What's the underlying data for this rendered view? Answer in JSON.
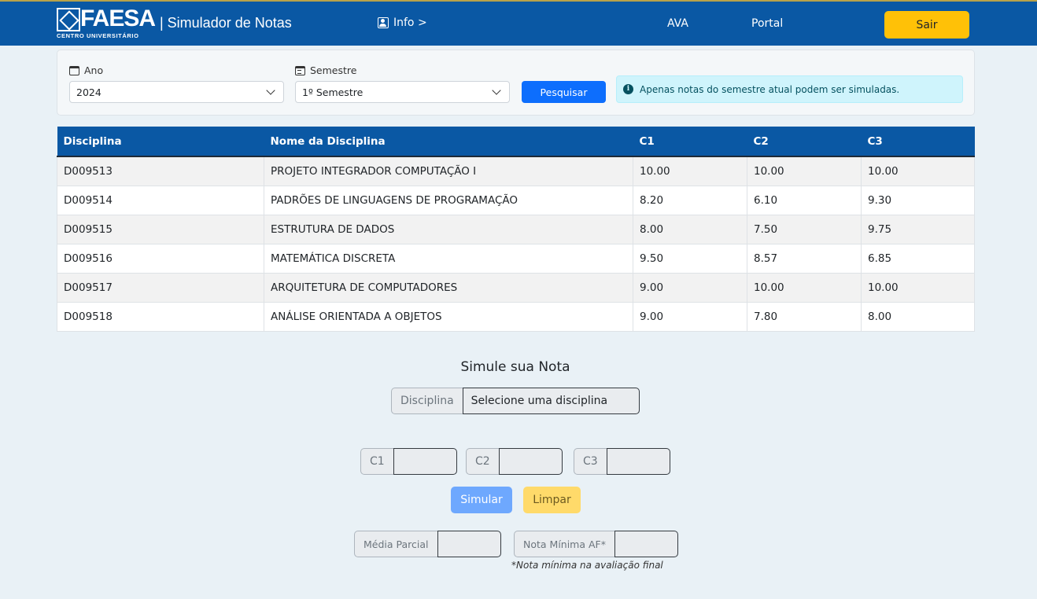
{
  "header": {
    "logo_text": "FAESA",
    "logo_subtext": "CENTRO UNIVERSITÁRIO",
    "app_title": "| Simulador de Notas",
    "info_label": "Info >",
    "nav_ava": "AVA",
    "nav_portal": "Portal",
    "logout_label": "Sair"
  },
  "filters": {
    "year_label": "Ano",
    "year_value": "2024",
    "semester_label": "Semestre",
    "semester_value": "1º Semestre",
    "search_label": "Pesquisar",
    "alert_text": "Apenas notas do semestre atual podem ser simuladas."
  },
  "table": {
    "headers": [
      "Disciplina",
      "Nome da Disciplina",
      "C1",
      "C2",
      "C3"
    ],
    "rows": [
      [
        "D009513",
        "PROJETO INTEGRADOR COMPUTAÇÃO I",
        "10.00",
        "10.00",
        "10.00"
      ],
      [
        "D009514",
        "PADRÕES DE LINGUAGENS DE PROGRAMAÇÃO",
        "8.20",
        "6.10",
        "9.30"
      ],
      [
        "D009515",
        "ESTRUTURA DE DADOS",
        "8.00",
        "7.50",
        "9.75"
      ],
      [
        "D009516",
        "MATEMÁTICA DISCRETA",
        "9.50",
        "8.57",
        "6.85"
      ],
      [
        "D009517",
        "ARQUITETURA DE COMPUTADORES",
        "9.00",
        "10.00",
        "10.00"
      ],
      [
        "D009518",
        "ANÁLISE ORIENTADA A OBJETOS",
        "9.00",
        "7.80",
        "8.00"
      ]
    ]
  },
  "simulator": {
    "title": "Simule sua Nota",
    "discipline_label": "Disciplina",
    "discipline_value": "Selecione uma disciplina",
    "c1_label": "C1",
    "c1_value": "",
    "c2_label": "C2",
    "c2_value": "",
    "c3_label": "C3",
    "c3_value": "",
    "simulate_label": "Simular",
    "clear_label": "Limpar",
    "partial_avg_label": "Média Parcial",
    "partial_avg_value": "",
    "min_grade_label": "Nota Mínima AF*",
    "min_grade_value": "",
    "footnote": "*Nota mínima na avaliação final"
  }
}
